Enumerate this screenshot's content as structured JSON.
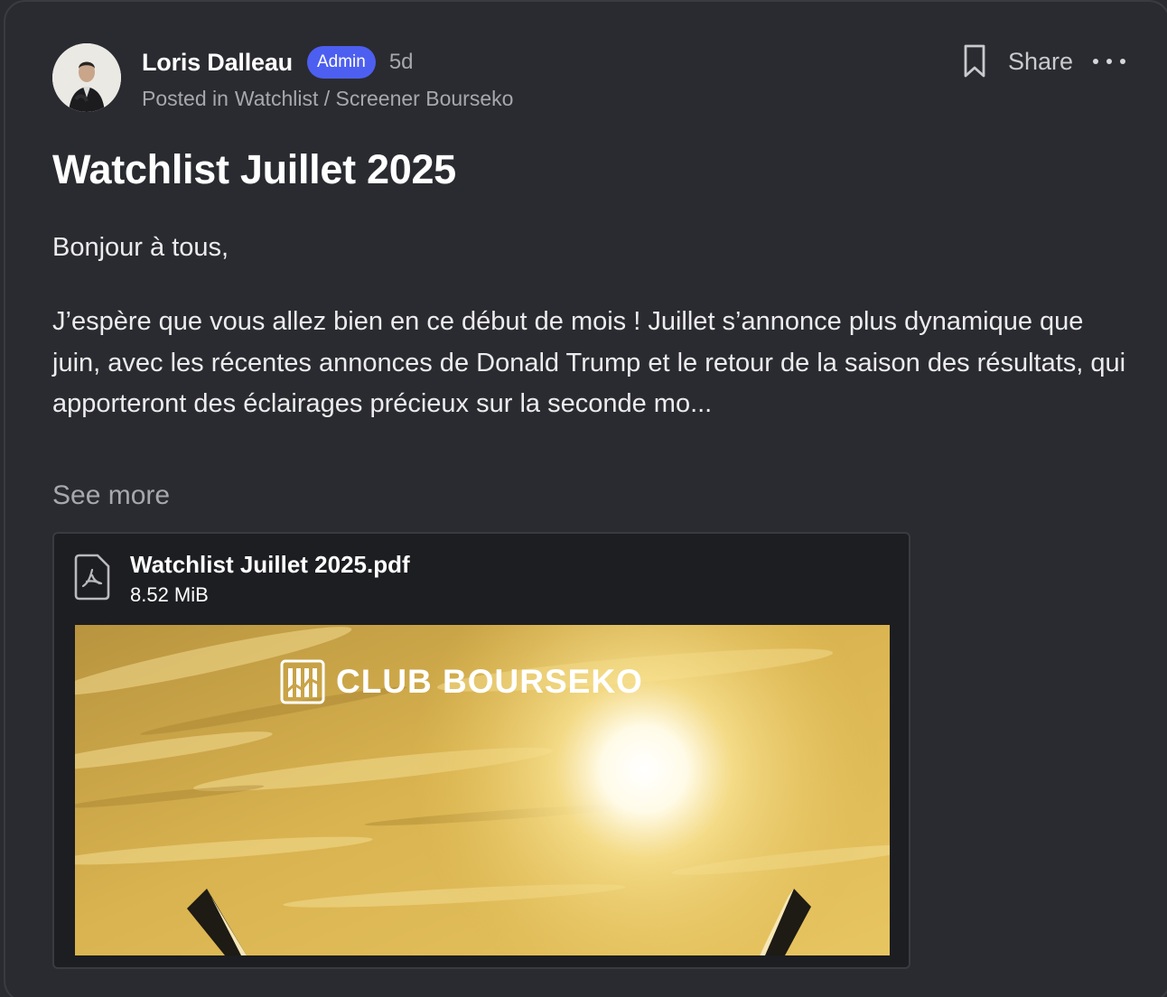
{
  "post": {
    "author": "Loris Dalleau",
    "badge": "Admin",
    "time": "5d",
    "posted_prefix": "Posted in",
    "category": "Watchlist / Screener Bourseko",
    "title": "Watchlist Juillet 2025",
    "greeting": "Bonjour à tous,",
    "body": "J’espère que vous allez bien en ce début de mois ! Juillet s’annonce plus dynamique que juin, avec les récentes annonces de Donald Trump et le retour de la saison des résultats, qui apporteront des éclairages précieux sur la seconde mo...",
    "see_more": "See more"
  },
  "actions": {
    "bookmark_icon": "bookmark-icon",
    "share_label": "Share",
    "more_icon": "more-horizontal-icon"
  },
  "attachment": {
    "icon": "pdf-file-icon",
    "file_name": "Watchlist Juillet 2025.pdf",
    "file_size": "8.52 MiB",
    "preview_logo_text": "CLUB BOURSEKO"
  },
  "colors": {
    "background": "#2a2b30",
    "badge": "#4d5ff0",
    "muted_text": "#a7a8ad",
    "attachment_bg": "#1d1e22"
  }
}
